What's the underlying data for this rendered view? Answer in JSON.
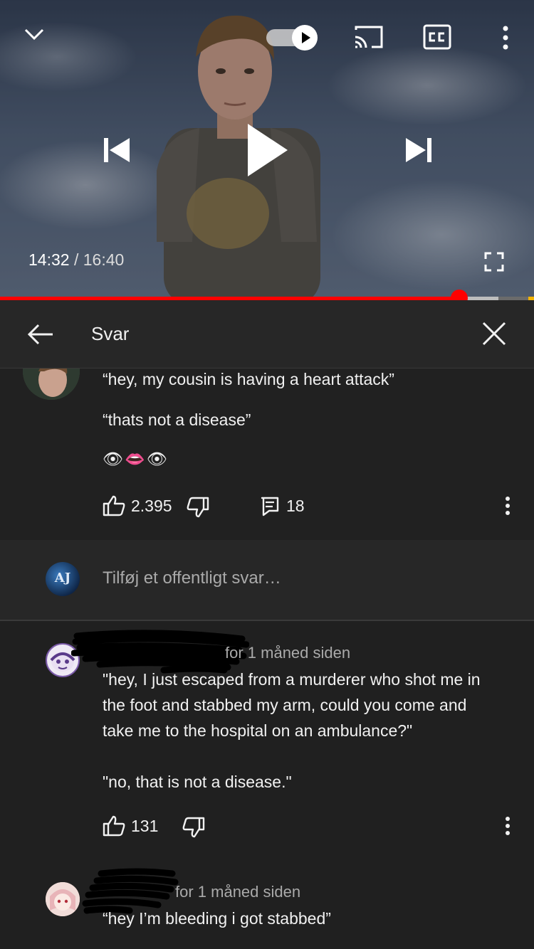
{
  "player": {
    "current_time": "14:32",
    "separator": "/",
    "duration": "16:40",
    "progress_fraction": 0.86,
    "autoplay_on": true
  },
  "replies_header": {
    "title": "Svar"
  },
  "parent_comment": {
    "lines": [
      "“hey, my cousin is having a heart attack”",
      "“thats not a disease”",
      "👁👄👁"
    ],
    "likes": "2.395",
    "replies": "18"
  },
  "reply_input": {
    "placeholder": "Tilføj et offentligt svar…",
    "avatar_initials": "AJ"
  },
  "replies": [
    {
      "timestamp": "for 1 måned siden",
      "text": "\"hey, I just escaped from a murderer who shot me in\nthe foot and stabbed my arm, could you come and\ntake me to the hospital on an ambulance?\"\n\n\"no, that is not a disease.\"",
      "likes": "131"
    },
    {
      "timestamp": "for 1 måned siden",
      "text": "“hey I’m bleeding i got stabbed”"
    }
  ],
  "colors": {
    "accent": "#ff0000",
    "background": "#202020",
    "header": "#272727",
    "secondary_text": "#aaaaaa"
  }
}
